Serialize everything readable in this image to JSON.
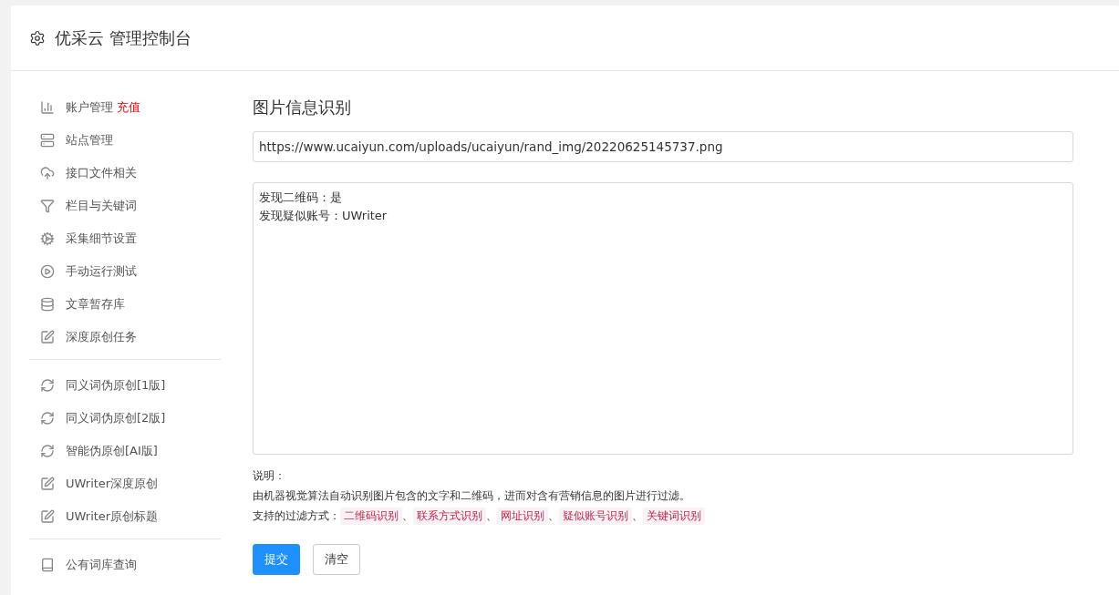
{
  "header": {
    "title": "优采云 管理控制台"
  },
  "sidebar": {
    "groups": [
      {
        "items": [
          {
            "label": "账户管理",
            "badge": "充值"
          },
          {
            "label": "站点管理"
          },
          {
            "label": "接口文件相关"
          },
          {
            "label": "栏目与关键词"
          },
          {
            "label": "采集细节设置"
          },
          {
            "label": "手动运行测试"
          },
          {
            "label": "文章暂存库"
          },
          {
            "label": "深度原创任务"
          }
        ]
      },
      {
        "items": [
          {
            "label": "同义词伪原创[1版]"
          },
          {
            "label": "同义词伪原创[2版]"
          },
          {
            "label": "智能伪原创[AI版]"
          },
          {
            "label": "UWriter深度原创"
          },
          {
            "label": "UWriter原创标题"
          }
        ]
      },
      {
        "items": [
          {
            "label": "公有词库查询"
          }
        ]
      }
    ]
  },
  "main": {
    "title": "图片信息识别",
    "url_field": {
      "value": "https://www.ucaiyun.com/uploads/ucaiyun/rand_img/20220625145737.png"
    },
    "result_box": {
      "lines": [
        "发现二维码：是",
        "发现疑似账号：UWriter"
      ]
    },
    "notes": {
      "heading": "说明：",
      "description": "由机器视觉算法自动识别图片包含的文字和二维码，进而对含有营销信息的图片进行过滤。",
      "methods_label": "支持的过滤方式：",
      "separator": "、",
      "methods": [
        "二维码识别",
        "联系方式识别",
        "网址识别",
        "疑似账号识别",
        "关键词识别"
      ]
    },
    "buttons": [
      {
        "label": "提交",
        "kind": "primary"
      },
      {
        "label": "清空",
        "kind": "default"
      }
    ]
  }
}
